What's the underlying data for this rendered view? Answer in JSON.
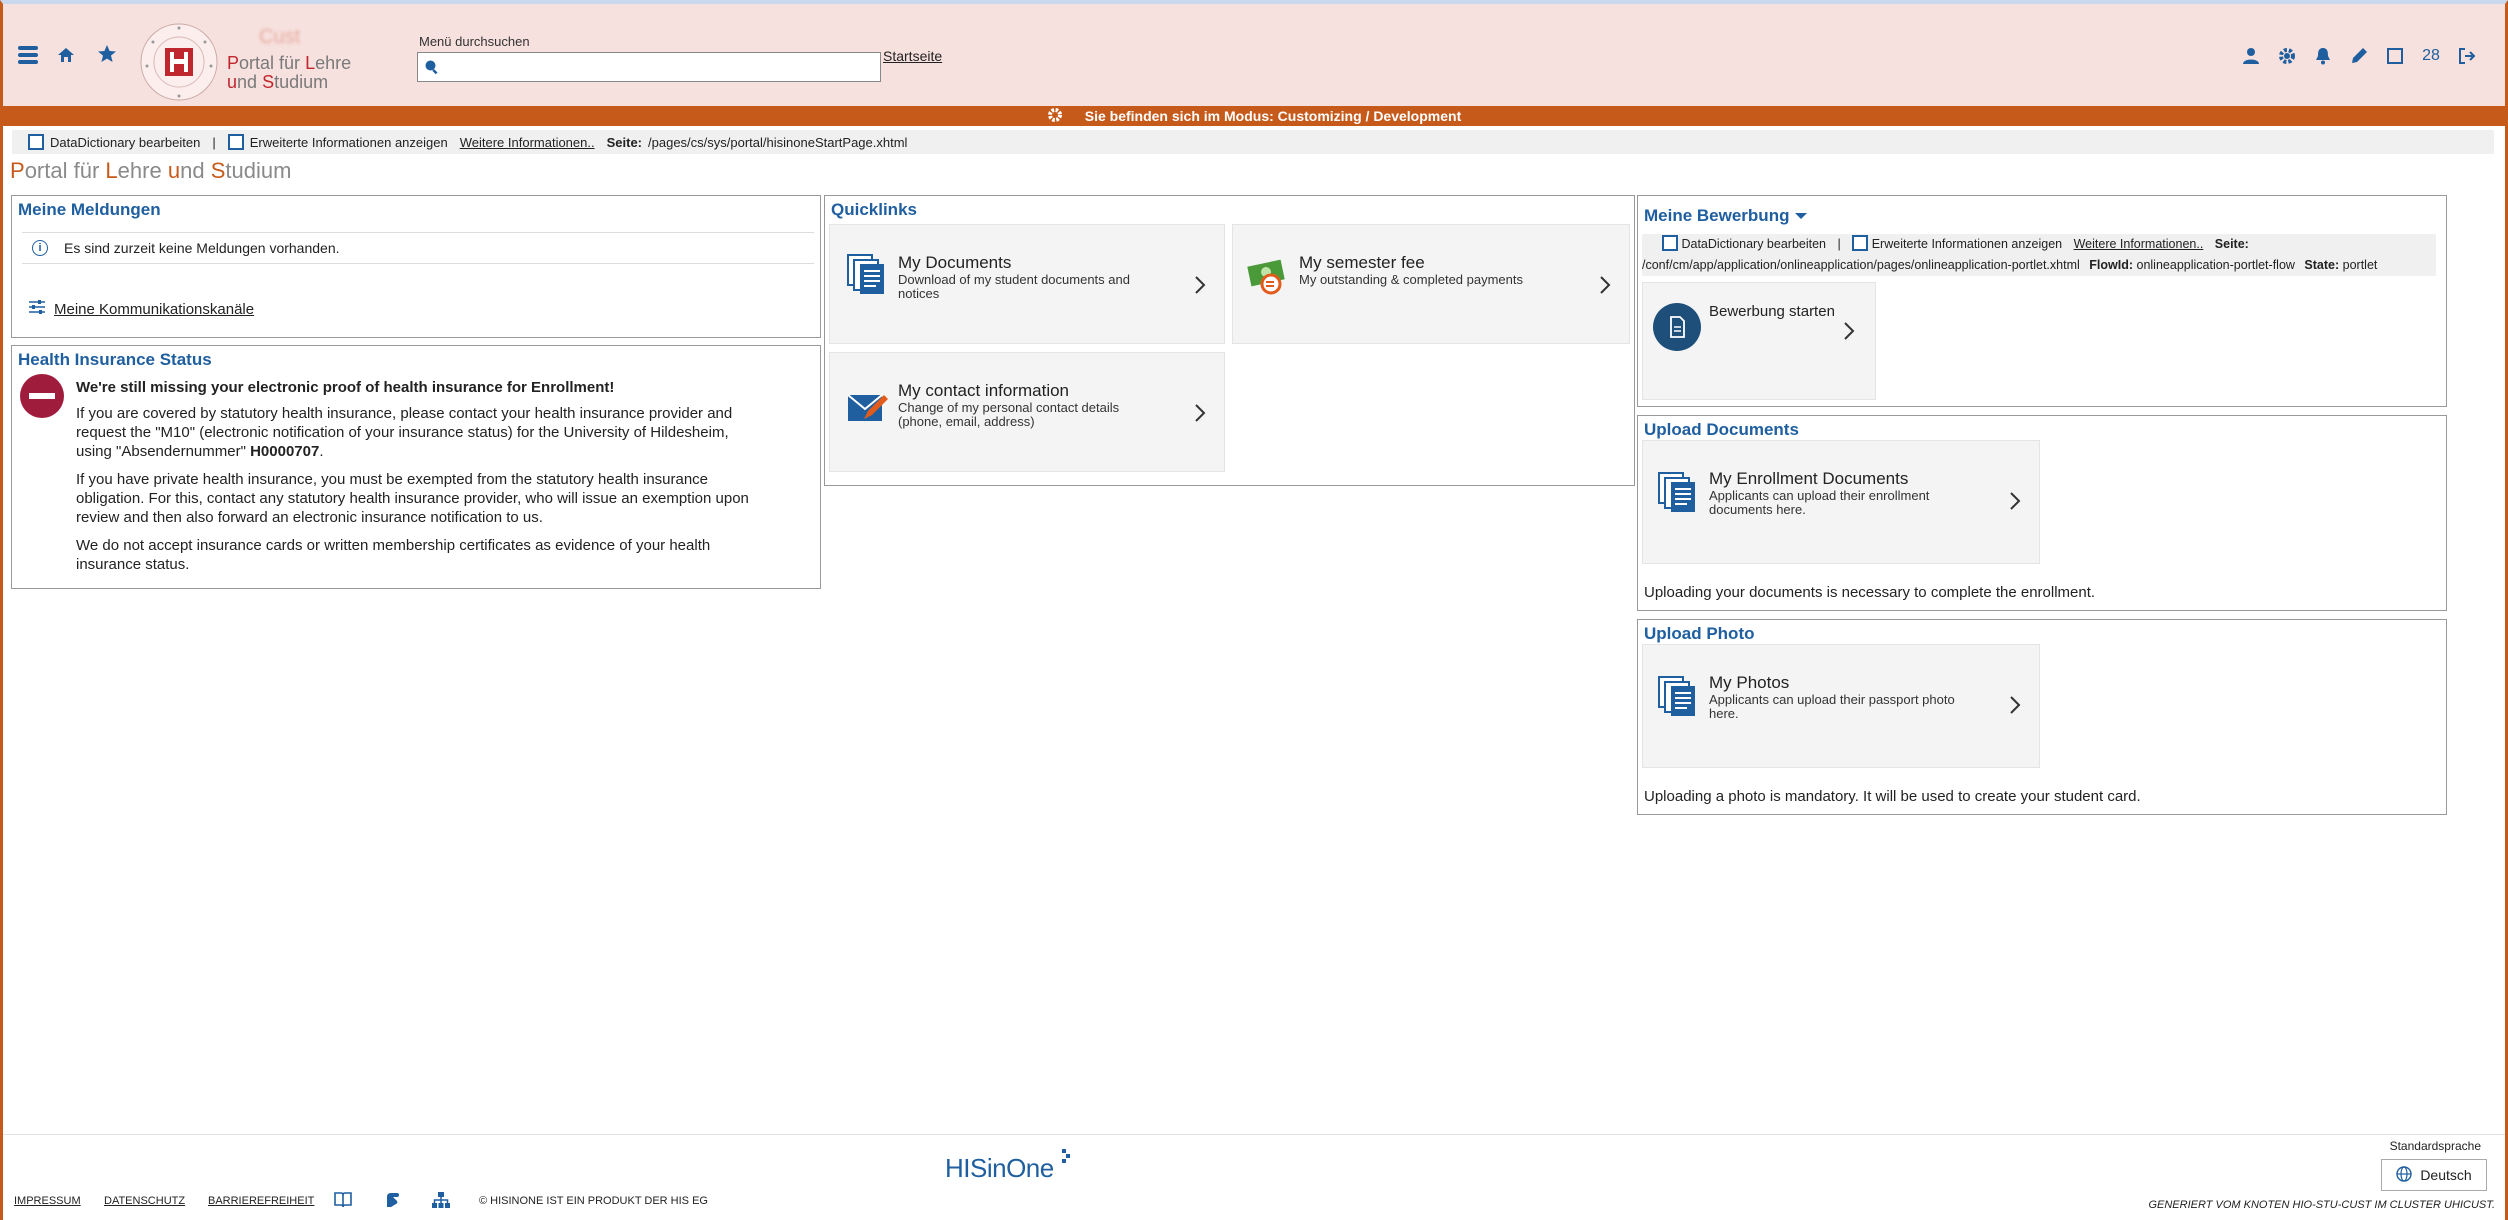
{
  "header": {
    "logo_cust": "Cust",
    "logo_line1": "Portal für Lehre",
    "logo_line2": "und Studium",
    "search_label": "Menü durchsuchen",
    "search_value": "",
    "startseite": "Startseite",
    "counter": "28"
  },
  "modebar": {
    "text": "Sie befinden sich im Modus: Customizing / Development"
  },
  "ddbar": {
    "dd_label": "DataDictionary bearbeiten",
    "sep": "|",
    "ext_label": "Erweiterte Informationen anzeigen",
    "more": "Weitere Informationen..",
    "page_key": "Seite:",
    "page_value": "/pages/cs/sys/portal/hisinoneStartPage.xhtml"
  },
  "page_title": "Portal für Lehre und Studium",
  "meldungen": {
    "title": "Meine Meldungen",
    "empty": "Es sind zurzeit keine Meldungen vorhanden.",
    "channels": "Meine Kommunikationskanäle"
  },
  "health": {
    "title": "Health Insurance Status",
    "headline": "We're still missing your electronic proof of health insurance for Enrollment!",
    "p1_a": "If you are covered by statutory health insurance, please contact your health insurance provider and request the \"M10\" (electronic notification of your insurance status) for the University of Hildesheim, using \"Absendernummer\" ",
    "p1_b": "H0000707",
    "p1_c": ".",
    "p2": "If you have private health insurance, you must be exempted from the statutory health insurance obligation. For this, contact any statutory health insurance provider, who will issue an exemption upon review and then also forward an electronic insurance notification to us.",
    "p3": "We do not accept insurance cards or written membership certificates as evidence of your health insurance status."
  },
  "quicklinks": {
    "title": "Quicklinks",
    "tiles": [
      {
        "title": "My Documents",
        "sub": "Download of my student documents and notices"
      },
      {
        "title": "My semester fee",
        "sub": "My outstanding & completed payments"
      },
      {
        "title": "My contact information",
        "sub": "Change of my personal contact details (phone, email, address)"
      }
    ]
  },
  "bewerbung": {
    "title": "Meine Bewerbung",
    "dd_label": "DataDictionary bearbeiten",
    "sep": "|",
    "ext_label": "Erweiterte Informationen anzeigen",
    "more": "Weitere Informationen..",
    "page_key": "Seite:",
    "page_value": "/conf/cm/app/application/onlineapplication/pages/onlineapplication-portlet.xhtml",
    "flow_key": "FlowId:",
    "flow_value": "onlineapplication-portlet-flow",
    "state_key": "State:",
    "state_value": "portlet",
    "start": "Bewerbung starten"
  },
  "upload_docs": {
    "title": "Upload Documents",
    "tile_title": "My Enrollment Documents",
    "tile_sub": "Applicants can upload their enrollment documents here.",
    "note": "Uploading your documents is necessary to complete the enrollment."
  },
  "upload_photo": {
    "title": "Upload Photo",
    "tile_title": "My Photos",
    "tile_sub": "Applicants can upload their passport photo here.",
    "note": "Uploading a photo is mandatory. It will be used to create your student card."
  },
  "footer": {
    "impressum": "IMPRESSUM",
    "datenschutz": "DATENSCHUTZ",
    "barriere": "BARRIEREFREIHEIT",
    "copyright": "© HISINONE IST EIN PRODUKT DER HIS EG",
    "brand": "HISinOne",
    "std_label": "Standardsprache",
    "lang": "Deutsch",
    "generated": "GENERIERT VOM KNOTEN HIO-STU-CUST IM CLUSTER UHICUST."
  },
  "colors": {
    "accent": "#1f5fa0",
    "modebar": "#c65a1b",
    "header_bg": "#f6e1de",
    "stop": "#a01c3c"
  }
}
